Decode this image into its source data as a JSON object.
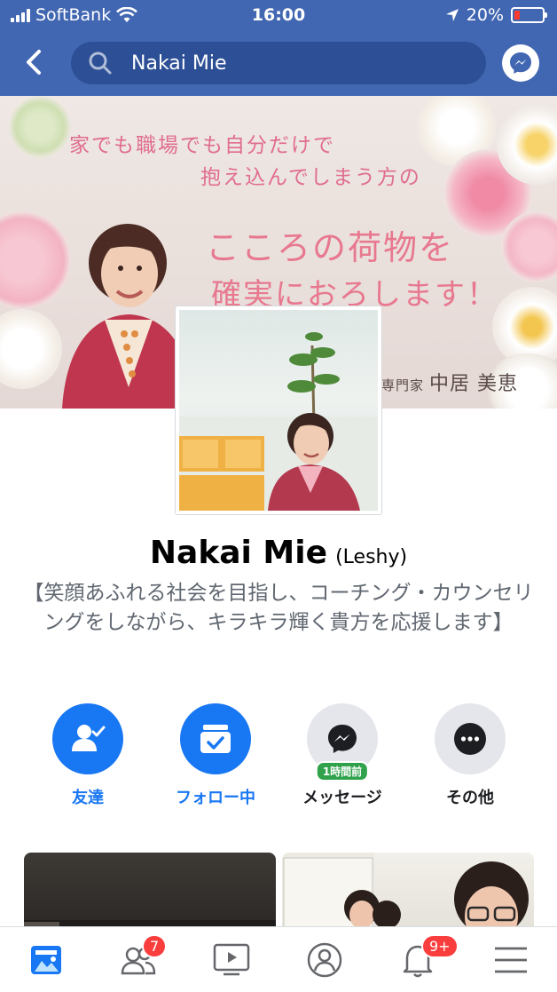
{
  "status_bar": {
    "carrier": "SoftBank",
    "time": "16:00",
    "battery": "20%"
  },
  "search": {
    "query": "Nakai Mie"
  },
  "cover": {
    "line1": "家でも職場でも自分だけで",
    "line2": "抱え込んでしまう方の",
    "line3": "こころの荷物を",
    "line4": "確実におろします！",
    "signature_prefix": "専門家",
    "signature_name": "中居 美恵"
  },
  "profile": {
    "name": "Nakai Mie",
    "alt_name": "(Leshy)",
    "bio": "【笑顔あふれる社会を目指し、コーチング・カウンセリングをしながら、キラキラ輝く貴方を応援します】"
  },
  "actions": [
    {
      "label": "友達",
      "icon": "friends-check-icon"
    },
    {
      "label": "フォロー中",
      "icon": "following-inbox-icon"
    },
    {
      "label": "メッセージ",
      "icon": "messenger-icon",
      "badge": "1時間前"
    },
    {
      "label": "その他",
      "icon": "more-dots-icon"
    }
  ],
  "tabbar": {
    "friends_badge": "7",
    "notifications_badge": "9+"
  },
  "colors": {
    "header_blue": "#4267b2",
    "accent_blue": "#1877f2",
    "badge_red": "#fa3e3e",
    "active_green": "#31a24c"
  }
}
